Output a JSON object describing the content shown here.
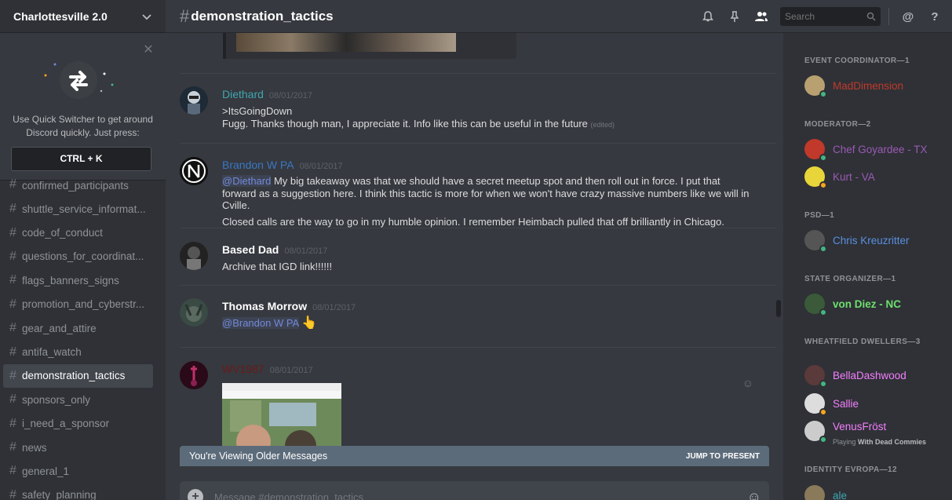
{
  "sidebar": {
    "server_name": "Charlottesville 2.0",
    "quick_switcher": {
      "text": "Use Quick Switcher to get around Discord quickly. Just press:",
      "shortcut": "CTRL + K"
    },
    "channels": [
      {
        "name": "confirmed_participants",
        "active": false
      },
      {
        "name": "shuttle_service_informat...",
        "active": false
      },
      {
        "name": "code_of_conduct",
        "active": false
      },
      {
        "name": "questions_for_coordinat...",
        "active": false
      },
      {
        "name": "flags_banners_signs",
        "active": false
      },
      {
        "name": "promotion_and_cyberstr...",
        "active": false
      },
      {
        "name": "gear_and_attire",
        "active": false
      },
      {
        "name": "antifa_watch",
        "active": false
      },
      {
        "name": "demonstration_tactics",
        "active": true
      },
      {
        "name": "sponsors_only",
        "active": false
      },
      {
        "name": "i_need_a_sponsor",
        "active": false
      },
      {
        "name": "news",
        "active": false
      },
      {
        "name": "general_1",
        "active": false
      },
      {
        "name": "safety_planning",
        "active": false
      }
    ]
  },
  "header": {
    "channel_name": "demonstration_tactics",
    "search_placeholder": "Search"
  },
  "messages": [
    {
      "user": "Diethard",
      "user_color": "#3fa7b0",
      "time": "08/01/2017",
      "lines": [
        ">ItsGoingDown",
        "Fugg. Thanks though man, I appreciate it. Info like this can be useful in the future"
      ],
      "edited": "(edited)"
    },
    {
      "user": "Brandon W PA",
      "user_color": "#3a77c4",
      "time": "08/01/2017",
      "mention": "@Diethard",
      "text1": " My big takeaway was that we should have a secret meetup spot and then roll out in force. I put that forward as a suggestion here. I think this tactic is more for when we won't have crazy massive numbers like we will in Cville.",
      "text2": "Closed calls are the way to go in my humble opinion. I remember Heimbach pulled that off brilliantly in Chicago."
    },
    {
      "user": "Based Dad",
      "user_color": "#ffffff",
      "time": "08/01/2017",
      "lines": [
        "Archive that IGD link!!!!!!"
      ]
    },
    {
      "user": "Thomas Morrow",
      "user_color": "#ffffff",
      "time": "08/01/2017",
      "mention": "@Brandon W PA",
      "emoji": "👆"
    },
    {
      "user": "WV1987",
      "user_color": "#6b1a1a",
      "time": "08/01/2017"
    }
  ],
  "older_bar": {
    "text": "You're Viewing Older Messages",
    "jump": "JUMP TO PRESENT"
  },
  "composer": {
    "placeholder": "Message #demonstration_tactics"
  },
  "member_groups": [
    {
      "role": "EVENT COORDINATOR—1",
      "members": [
        {
          "name": "MadDimension",
          "color": "#c0392b",
          "status": "#43b581",
          "avatar": "#b8a070"
        }
      ]
    },
    {
      "role": "MODERATOR—2",
      "members": [
        {
          "name": "Chef Goyardee - TX",
          "color": "#9b59b6",
          "status": "#43b581",
          "avatar": "#c0392b"
        },
        {
          "name": "Kurt - VA",
          "color": "#9b59b6",
          "status": "#faa61a",
          "avatar": "#e8d53a"
        }
      ]
    },
    {
      "role": "PSD—1",
      "members": [
        {
          "name": "Chris Kreuzritter",
          "color": "#5a8fe0",
          "status": "#43b581",
          "avatar": "#555555"
        }
      ]
    },
    {
      "role": "STATE ORGANIZER—1",
      "members": [
        {
          "name": "von Diez - NC",
          "color": "#6ee06e",
          "status": "#43b581",
          "avatar": "#3a5a3a"
        }
      ]
    },
    {
      "role": "WHEATFIELD DWELLERS—3",
      "members": [
        {
          "name": "BellaDashwood",
          "color": "#f47fff",
          "status": "#43b581",
          "avatar": "#5a3a3a"
        },
        {
          "name": "Sallie",
          "color": "#f47fff",
          "status": "#faa61a",
          "avatar": "#dddddd"
        },
        {
          "name": "VenusFröst",
          "color": "#f47fff",
          "status": "#43b581",
          "avatar": "#cccccc",
          "playing": "Playing",
          "game": "With Dead Commies"
        }
      ]
    },
    {
      "role": "IDENTITY EVROPA—12",
      "members": [
        {
          "name": "ale",
          "color": "#3fa7b0",
          "status": "#43b581",
          "avatar": "#8a7a5a"
        }
      ]
    }
  ]
}
